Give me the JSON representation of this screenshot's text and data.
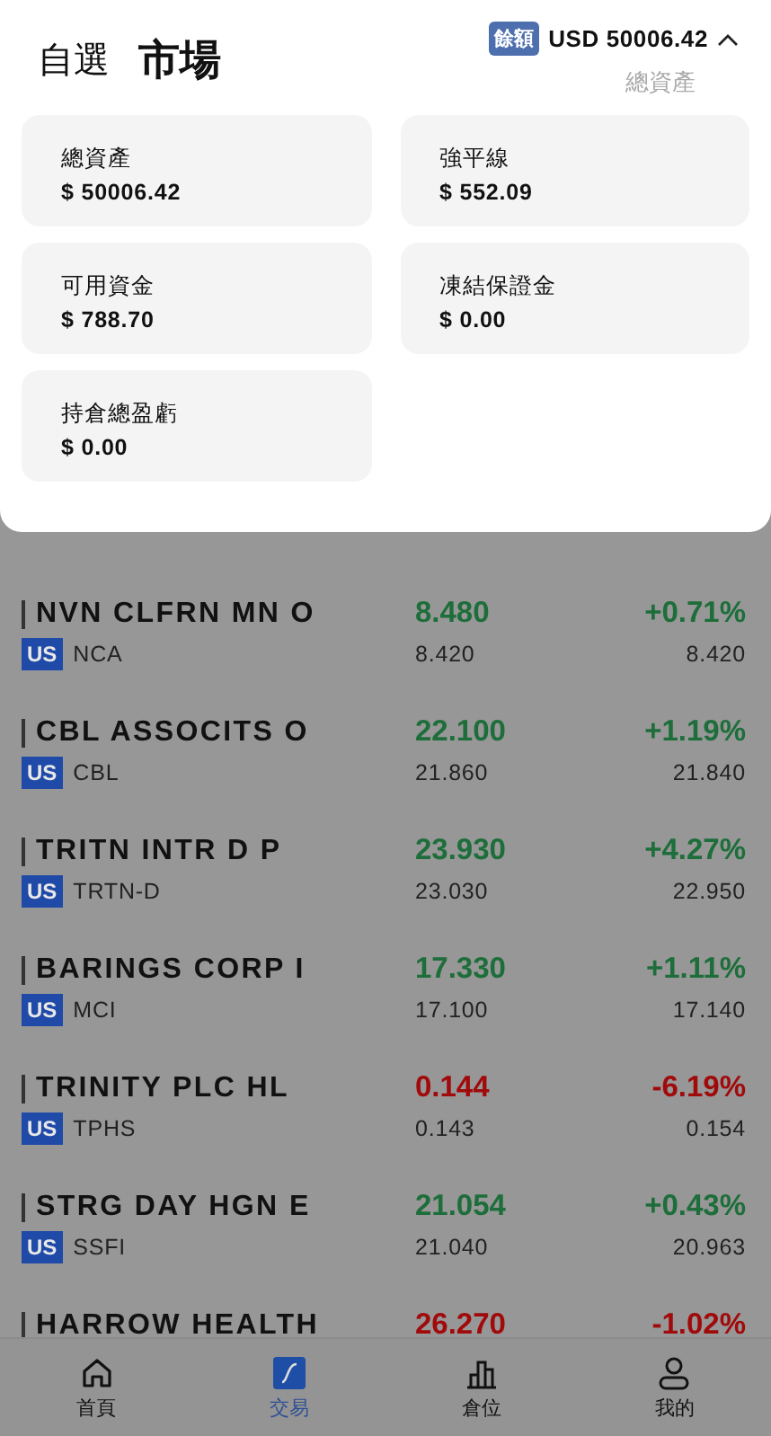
{
  "header": {
    "tabs": [
      {
        "label": "自選",
        "selected": false
      },
      {
        "label": "市場",
        "selected": true
      }
    ],
    "balance": {
      "badge": "餘額",
      "amount": "USD 50006.42",
      "caption": "總資產",
      "expanded": true
    }
  },
  "summary": [
    {
      "label": "總資產",
      "value": "$ 50006.42"
    },
    {
      "label": "強平線",
      "value": "$ 552.09"
    },
    {
      "label": "可用資金",
      "value": "$ 788.70"
    },
    {
      "label": "凍結保證金",
      "value": "$ 0.00"
    },
    {
      "label": "持倉總盈虧",
      "value": "$ 0.00"
    }
  ],
  "stocks": [
    {
      "kind": "full",
      "name": "NVN CLFRN MN O",
      "color": "#1d6e3a",
      "price": "8.480",
      "change": "+0.71%",
      "market": "US",
      "code": "NCA",
      "price_2": "8.420",
      "price_3": "8.420"
    },
    {
      "kind": "full",
      "name": "CBL ASSOCITS O",
      "color": "#1d6e3a",
      "price": "22.100",
      "change": "+1.19%",
      "market": "US",
      "code": "CBL",
      "price_2": "21.860",
      "price_3": "21.840"
    },
    {
      "kind": "full",
      "name": "TRITN INTR D P",
      "color": "#1d6e3a",
      "price": "23.930",
      "change": "+4.27%",
      "market": "US",
      "code": "TRTN-D",
      "price_2": "23.030",
      "price_3": "22.950"
    },
    {
      "kind": "full",
      "name": "BARINGS CORP I",
      "color": "#1d6e3a",
      "price": "17.330",
      "change": "+1.11%",
      "market": "US",
      "code": "MCI",
      "price_2": "17.100",
      "price_3": "17.140"
    },
    {
      "kind": "full",
      "name": "TRINITY PLC HL",
      "color": "#a10a0a",
      "price": "0.144",
      "change": "-6.19%",
      "market": "US",
      "code": "TPHS",
      "price_2": "0.143",
      "price_3": "0.154"
    },
    {
      "kind": "full",
      "name": "STRG DAY HGN E",
      "color": "#1d6e3a",
      "price": "21.054",
      "change": "+0.43%",
      "market": "US",
      "code": "SSFI",
      "price_2": "21.040",
      "price_3": "20.963"
    },
    {
      "kind": "main_only",
      "name": "HARROW HEALTH",
      "color": "#a10a0a",
      "price": "26.270",
      "change": "-1.02%"
    }
  ],
  "nav": [
    {
      "label": "首頁",
      "selected": false
    },
    {
      "label": "交易",
      "selected": true
    },
    {
      "label": "倉位",
      "selected": false
    },
    {
      "label": "我的",
      "selected": false
    }
  ]
}
